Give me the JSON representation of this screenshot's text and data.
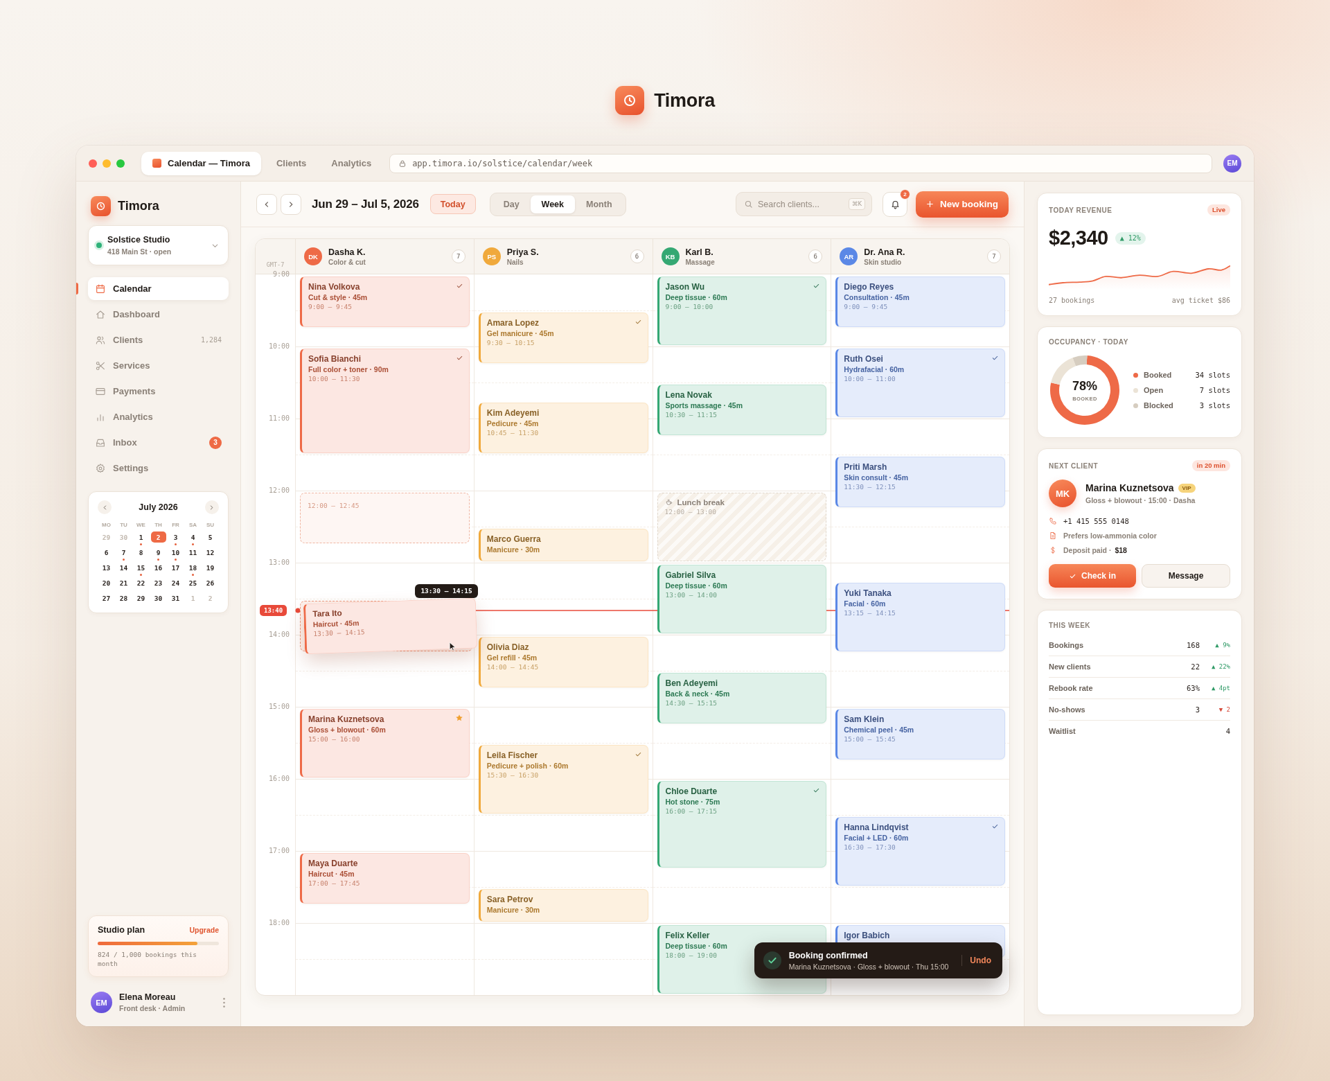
{
  "hero": {
    "brand": "Timora"
  },
  "browser": {
    "tabs": [
      {
        "label": "Calendar — Timora",
        "selected": true
      },
      {
        "label": "Clients",
        "selected": false
      },
      {
        "label": "Analytics",
        "selected": false
      }
    ],
    "url": "app.timora.io/solstice/calendar/week",
    "avatar": "EM"
  },
  "sidebar": {
    "brand": "Timora",
    "studio": {
      "name": "Solstice Studio",
      "address": "418 Main St · open",
      "open": true
    },
    "nav": [
      {
        "label": "Calendar",
        "selected": true
      },
      {
        "label": "Dashboard",
        "selected": false
      },
      {
        "label": "Clients",
        "count": "1,284",
        "selected": false
      },
      {
        "label": "Services",
        "selected": false
      },
      {
        "label": "Payments",
        "selected": false
      },
      {
        "label": "Analytics",
        "selected": false
      },
      {
        "label": "Inbox",
        "badge": "3",
        "selected": false
      },
      {
        "label": "Settings",
        "selected": false
      }
    ],
    "mini_calendar": {
      "title": "July 2026",
      "weekdays": [
        "MO",
        "TU",
        "WE",
        "TH",
        "FR",
        "SA",
        "SU"
      ],
      "days": [
        {
          "label": "29",
          "muted": true,
          "selected": false,
          "has_bookings": false
        },
        {
          "label": "30",
          "muted": true,
          "selected": false,
          "has_bookings": false
        },
        {
          "label": "1",
          "muted": false,
          "selected": false,
          "has_bookings": true
        },
        {
          "label": "2",
          "muted": false,
          "selected": true,
          "has_bookings": false
        },
        {
          "label": "3",
          "muted": false,
          "selected": false,
          "has_bookings": true
        },
        {
          "label": "4",
          "muted": false,
          "selected": false,
          "has_bookings": true
        },
        {
          "label": "5",
          "muted": false,
          "selected": false,
          "has_bookings": false
        },
        {
          "label": "6",
          "muted": false,
          "selected": false,
          "has_bookings": false
        },
        {
          "label": "7",
          "muted": false,
          "selected": false,
          "has_bookings": true
        },
        {
          "label": "8",
          "muted": false,
          "selected": false,
          "has_bookings": false
        },
        {
          "label": "9",
          "muted": false,
          "selected": false,
          "has_bookings": true
        },
        {
          "label": "10",
          "muted": false,
          "selected": false,
          "has_bookings": true
        },
        {
          "label": "11",
          "muted": false,
          "selected": false,
          "has_bookings": false
        },
        {
          "label": "12",
          "muted": false,
          "selected": false,
          "has_bookings": false
        },
        {
          "label": "13",
          "muted": false,
          "selected": false,
          "has_bookings": false
        },
        {
          "label": "14",
          "muted": false,
          "selected": false,
          "has_bookings": false
        },
        {
          "label": "15",
          "muted": false,
          "selected": false,
          "has_bookings": true
        },
        {
          "label": "16",
          "muted": false,
          "selected": false,
          "has_bookings": false
        },
        {
          "label": "17",
          "muted": false,
          "selected": false,
          "has_bookings": false
        },
        {
          "label": "18",
          "muted": false,
          "selected": false,
          "has_bookings": true
        },
        {
          "label": "19",
          "muted": false,
          "selected": false,
          "has_bookings": false
        },
        {
          "label": "20",
          "muted": false,
          "selected": false,
          "has_bookings": false
        },
        {
          "label": "21",
          "muted": false,
          "selected": false,
          "has_bookings": false
        },
        {
          "label": "22",
          "muted": false,
          "selected": false,
          "has_bookings": false
        },
        {
          "label": "23",
          "muted": false,
          "selected": false,
          "has_bookings": false
        },
        {
          "label": "24",
          "muted": false,
          "selected": false,
          "has_bookings": false
        },
        {
          "label": "25",
          "muted": false,
          "selected": false,
          "has_bookings": false
        },
        {
          "label": "26",
          "muted": false,
          "selected": false,
          "has_bookings": false
        },
        {
          "label": "27",
          "muted": false,
          "selected": false,
          "has_bookings": false
        },
        {
          "label": "28",
          "muted": false,
          "selected": false,
          "has_bookings": false
        },
        {
          "label": "29",
          "muted": false,
          "selected": false,
          "has_bookings": false
        },
        {
          "label": "30",
          "muted": false,
          "selected": false,
          "has_bookings": false
        },
        {
          "label": "31",
          "muted": false,
          "selected": false,
          "has_bookings": false
        },
        {
          "label": "1",
          "muted": true,
          "selected": false,
          "has_bookings": false
        },
        {
          "label": "2",
          "muted": true,
          "selected": false,
          "has_bookings": false
        }
      ]
    },
    "plan": {
      "title": "Studio plan",
      "action": "Upgrade",
      "level": 0.824,
      "caption": "824 / 1,000 bookings this month"
    },
    "user": {
      "initials": "EM",
      "name": "Elena Moreau",
      "role": "Front desk · Admin"
    }
  },
  "toolbar": {
    "range": "Jun 29 – Jul 5, 2026",
    "today": "Today",
    "views": [
      {
        "label": "Day",
        "selected": false
      },
      {
        "label": "Week",
        "selected": true
      },
      {
        "label": "Month",
        "selected": false
      }
    ],
    "search": {
      "placeholder": "Search clients...",
      "shortcut": "⌘K"
    },
    "notifications": "2",
    "new_booking": "New booking"
  },
  "calendar": {
    "timezone": "GMT-7",
    "now": {
      "label": "13:40"
    },
    "columns": [
      {
        "initials": "DK",
        "name": "Dasha K.",
        "role": "Color & cut",
        "count": "7",
        "color": "#ee6a47"
      },
      {
        "initials": "PS",
        "name": "Priya S.",
        "role": "Nails",
        "count": "6",
        "color": "#f0a93c"
      },
      {
        "initials": "KB",
        "name": "Karl B.",
        "role": "Massage",
        "count": "6",
        "color": "#35a873"
      },
      {
        "initials": "AR",
        "name": "Dr. Ana R.",
        "role": "Skin studio",
        "count": "7",
        "color": "#5b88e6"
      }
    ],
    "rows": [
      {
        "label": "9:00",
        "cells": [
          {
            "events": [
              {
                "kind": "appointment",
                "name": "Nina Volkova",
                "service": "Cut & style · 45m",
                "time": "9:00 – 9:45",
                "confirmed": true,
                "starred": false
              }
            ]
          },
          {
            "events": [
              {
                "kind": "appointment",
                "name": "Amara Lopez",
                "service": "Gel manicure · 45m",
                "time": "9:30 – 10:15",
                "confirmed": true,
                "starred": false
              }
            ]
          },
          {
            "events": [
              {
                "kind": "appointment",
                "name": "Jason Wu",
                "service": "Deep tissue · 60m",
                "time": "9:00 – 10:00",
                "confirmed": true,
                "starred": false
              }
            ]
          },
          {
            "events": [
              {
                "kind": "appointment",
                "name": "Diego Reyes",
                "service": "Consultation · 45m",
                "time": "9:00 – 9:45",
                "confirmed": false,
                "starred": false
              }
            ]
          }
        ]
      },
      {
        "label": "10:00",
        "cells": [
          {
            "events": [
              {
                "kind": "appointment",
                "name": "Sofia Bianchi",
                "service": "Full color + toner · 90m",
                "time": "10:00 – 11:30",
                "confirmed": true,
                "starred": false
              }
            ]
          },
          {
            "events": [
              {
                "kind": "appointment",
                "name": "Kim Adeyemi",
                "service": "Pedicure · 45m",
                "time": "10:45 – 11:30",
                "confirmed": false,
                "starred": false
              }
            ]
          },
          {
            "events": [
              {
                "kind": "appointment",
                "name": "Lena Novak",
                "service": "Sports massage · 45m",
                "time": "10:30 – 11:15",
                "confirmed": false,
                "starred": false
              }
            ]
          },
          {
            "events": [
              {
                "kind": "appointment",
                "name": "Ruth Osei",
                "service": "Hydrafacial · 60m",
                "time": "10:00 – 11:00",
                "confirmed": true,
                "starred": false
              }
            ]
          }
        ]
      },
      {
        "label": "11:00",
        "cells": [
          {},
          {},
          {},
          {
            "events": [
              {
                "kind": "appointment",
                "name": "Priti Marsh",
                "service": "Skin consult · 45m",
                "time": "11:30 – 12:15",
                "confirmed": false,
                "starred": false
              }
            ]
          }
        ]
      },
      {
        "label": "12:00",
        "cells": [
          {
            "events": [
              {
                "kind": "ghost",
                "time": "12:00 – 12:45"
              }
            ]
          },
          {
            "events": [
              {
                "kind": "appointment",
                "name": "Marco Guerra",
                "service": "Manicure · 30m",
                "second_half": true,
                "confirmed": false,
                "starred": false
              }
            ]
          },
          {
            "events": [
              {
                "kind": "break",
                "title": "Lunch break",
                "time": "12:00 – 13:00"
              }
            ]
          },
          {}
        ]
      },
      {
        "label": "13:00",
        "cells": [
          {
            "events": [
              {
                "kind": "dragging",
                "name": "Tara Ito",
                "service": "Haircut · 45m",
                "time": "13:30 – 14:15",
                "tooltip": "13:30 – 14:15",
                "confirmed": false,
                "starred": false
              }
            ]
          },
          {},
          {
            "events": [
              {
                "kind": "appointment",
                "name": "Gabriel Silva",
                "service": "Deep tissue · 60m",
                "time": "13:00 – 14:00",
                "confirmed": false,
                "starred": false
              }
            ]
          },
          {
            "events": [
              {
                "kind": "appointment",
                "name": "Yuki Tanaka",
                "service": "Facial · 60m",
                "time": "13:15 – 14:15",
                "confirmed": false,
                "starred": false
              }
            ]
          }
        ]
      },
      {
        "label": "14:00",
        "cells": [
          {},
          {
            "events": [
              {
                "kind": "appointment",
                "name": "Olivia Diaz",
                "service": "Gel refill · 45m",
                "time": "14:00 – 14:45",
                "confirmed": false,
                "starred": false
              }
            ]
          },
          {
            "events": [
              {
                "kind": "appointment",
                "name": "Ben Adeyemi",
                "service": "Back & neck · 45m",
                "time": "14:30 – 15:15",
                "confirmed": false,
                "starred": false
              }
            ]
          },
          {}
        ]
      },
      {
        "label": "15:00",
        "cells": [
          {
            "events": [
              {
                "kind": "appointment",
                "name": "Marina Kuznetsova",
                "service": "Gloss + blowout · 60m",
                "time": "15:00 – 16:00",
                "confirmed": false,
                "starred": true
              }
            ]
          },
          {
            "events": [
              {
                "kind": "appointment",
                "name": "Leila Fischer",
                "service": "Pedicure + polish · 60m",
                "time": "15:30 – 16:30",
                "confirmed": true,
                "starred": false
              }
            ]
          },
          {},
          {
            "events": [
              {
                "kind": "appointment",
                "name": "Sam Klein",
                "service": "Chemical peel · 45m",
                "time": "15:00 – 15:45",
                "confirmed": false,
                "starred": false
              }
            ]
          }
        ]
      },
      {
        "label": "16:00",
        "cells": [
          {},
          {},
          {
            "events": [
              {
                "kind": "appointment",
                "name": "Chloe Duarte",
                "service": "Hot stone · 75m",
                "time": "16:00 – 17:15",
                "confirmed": true,
                "starred": false
              }
            ]
          },
          {
            "events": [
              {
                "kind": "appointment",
                "name": "Hanna Lindqvist",
                "service": "Facial + LED · 60m",
                "time": "16:30 – 17:30",
                "confirmed": true,
                "starred": false
              }
            ]
          }
        ]
      },
      {
        "label": "17:00",
        "cells": [
          {
            "events": [
              {
                "kind": "appointment",
                "name": "Maya Duarte",
                "service": "Haircut · 45m",
                "time": "17:00 – 17:45",
                "confirmed": false,
                "starred": false
              }
            ]
          },
          {
            "events": [
              {
                "kind": "appointment",
                "name": "Sara Petrov",
                "service": "Manicure · 30m",
                "second_half": true,
                "confirmed": false,
                "starred": false
              }
            ]
          },
          {},
          {}
        ]
      },
      {
        "label": "18:00",
        "cells": [
          {},
          {},
          {
            "events": [
              {
                "kind": "appointment",
                "name": "Felix Keller",
                "service": "Deep tissue · 60m",
                "time": "18:00 – 19:00",
                "confirmed": false,
                "starred": false
              }
            ]
          },
          {
            "events": [
              {
                "kind": "appointment",
                "name": "Igor Babich",
                "second_half": false,
                "confirmed": false,
                "starred": false
              }
            ]
          }
        ]
      }
    ]
  },
  "toast": {
    "title": "Booking confirmed",
    "message": "Marina Kuznetsova · Gloss + blowout · Thu 15:00",
    "action": "Undo"
  },
  "revenue": {
    "title": "TODAY REVENUE",
    "status": "Live",
    "amount": "$2,340",
    "change": "▲ 12%",
    "bookings": "27 bookings",
    "average": "avg ticket $86"
  },
  "occupancy": {
    "title": "OCCUPANCY · TODAY",
    "center_value": "78%",
    "center_label": "BOOKED",
    "legend": [
      {
        "value": "34 slots",
        "color": "#ee6a47"
      },
      {
        "value": "7 slots",
        "color": "#ebe3d6"
      },
      {
        "value": "3 slots",
        "color": "#d6cdc0"
      }
    ],
    "chart_data": {
      "type": "donut",
      "categories": [
        "Booked",
        "Open",
        "Blocked"
      ],
      "values": [
        77.3,
        15.9,
        6.8
      ]
    }
  },
  "next_client": {
    "title": "NEXT CLIENT",
    "eta": "in 20 min",
    "initials": "MK",
    "name": "Marina Kuznetsova",
    "badge": "VIP",
    "detail": "Gloss + blowout · 15:00 · Dasha",
    "info": [
      {
        "kind": "phone",
        "text": "+1 415 555 0148"
      },
      {
        "kind": "note",
        "text": "Prefers low-ammonia color"
      },
      {
        "kind": "deposit",
        "text": "Deposit paid ·",
        "amount": "$18"
      }
    ],
    "primary": "Check in",
    "secondary": "Message"
  },
  "this_week": {
    "title": "THIS WEEK",
    "rows": [
      {
        "label": "Bookings",
        "value": "168",
        "change": "▲ 9%",
        "positive": true
      },
      {
        "label": "New clients",
        "value": "22",
        "change": "▲ 22%",
        "positive": true
      },
      {
        "label": "Rebook rate",
        "value": "63%",
        "change": "▲ 4pt",
        "positive": true
      },
      {
        "label": "No-shows",
        "value": "3",
        "change": "▼ 2",
        "positive": false
      },
      {
        "label": "Waitlist",
        "value": "4"
      }
    ]
  }
}
